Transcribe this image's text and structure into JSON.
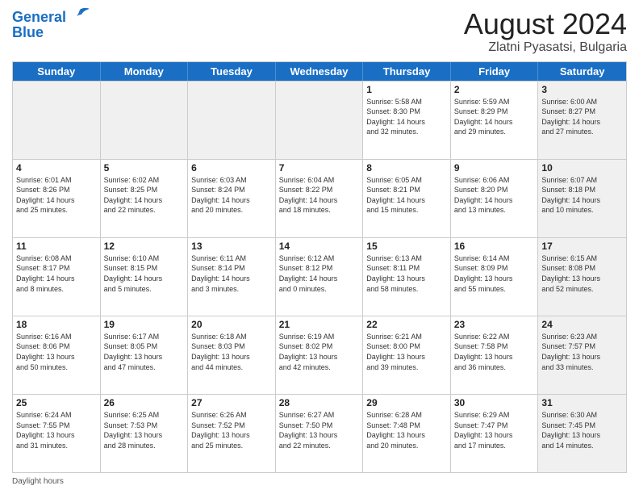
{
  "header": {
    "logo_line1": "General",
    "logo_line2": "Blue",
    "title": "August 2024",
    "subtitle": "Zlatni Pyasatsi, Bulgaria"
  },
  "weekdays": [
    "Sunday",
    "Monday",
    "Tuesday",
    "Wednesday",
    "Thursday",
    "Friday",
    "Saturday"
  ],
  "weeks": [
    [
      {
        "day": "",
        "info": "",
        "shaded": true
      },
      {
        "day": "",
        "info": "",
        "shaded": true
      },
      {
        "day": "",
        "info": "",
        "shaded": true
      },
      {
        "day": "",
        "info": "",
        "shaded": true
      },
      {
        "day": "1",
        "info": "Sunrise: 5:58 AM\nSunset: 8:30 PM\nDaylight: 14 hours\nand 32 minutes.",
        "shaded": false
      },
      {
        "day": "2",
        "info": "Sunrise: 5:59 AM\nSunset: 8:29 PM\nDaylight: 14 hours\nand 29 minutes.",
        "shaded": false
      },
      {
        "day": "3",
        "info": "Sunrise: 6:00 AM\nSunset: 8:27 PM\nDaylight: 14 hours\nand 27 minutes.",
        "shaded": true
      }
    ],
    [
      {
        "day": "4",
        "info": "Sunrise: 6:01 AM\nSunset: 8:26 PM\nDaylight: 14 hours\nand 25 minutes.",
        "shaded": false
      },
      {
        "day": "5",
        "info": "Sunrise: 6:02 AM\nSunset: 8:25 PM\nDaylight: 14 hours\nand 22 minutes.",
        "shaded": false
      },
      {
        "day": "6",
        "info": "Sunrise: 6:03 AM\nSunset: 8:24 PM\nDaylight: 14 hours\nand 20 minutes.",
        "shaded": false
      },
      {
        "day": "7",
        "info": "Sunrise: 6:04 AM\nSunset: 8:22 PM\nDaylight: 14 hours\nand 18 minutes.",
        "shaded": false
      },
      {
        "day": "8",
        "info": "Sunrise: 6:05 AM\nSunset: 8:21 PM\nDaylight: 14 hours\nand 15 minutes.",
        "shaded": false
      },
      {
        "day": "9",
        "info": "Sunrise: 6:06 AM\nSunset: 8:20 PM\nDaylight: 14 hours\nand 13 minutes.",
        "shaded": false
      },
      {
        "day": "10",
        "info": "Sunrise: 6:07 AM\nSunset: 8:18 PM\nDaylight: 14 hours\nand 10 minutes.",
        "shaded": true
      }
    ],
    [
      {
        "day": "11",
        "info": "Sunrise: 6:08 AM\nSunset: 8:17 PM\nDaylight: 14 hours\nand 8 minutes.",
        "shaded": false
      },
      {
        "day": "12",
        "info": "Sunrise: 6:10 AM\nSunset: 8:15 PM\nDaylight: 14 hours\nand 5 minutes.",
        "shaded": false
      },
      {
        "day": "13",
        "info": "Sunrise: 6:11 AM\nSunset: 8:14 PM\nDaylight: 14 hours\nand 3 minutes.",
        "shaded": false
      },
      {
        "day": "14",
        "info": "Sunrise: 6:12 AM\nSunset: 8:12 PM\nDaylight: 14 hours\nand 0 minutes.",
        "shaded": false
      },
      {
        "day": "15",
        "info": "Sunrise: 6:13 AM\nSunset: 8:11 PM\nDaylight: 13 hours\nand 58 minutes.",
        "shaded": false
      },
      {
        "day": "16",
        "info": "Sunrise: 6:14 AM\nSunset: 8:09 PM\nDaylight: 13 hours\nand 55 minutes.",
        "shaded": false
      },
      {
        "day": "17",
        "info": "Sunrise: 6:15 AM\nSunset: 8:08 PM\nDaylight: 13 hours\nand 52 minutes.",
        "shaded": true
      }
    ],
    [
      {
        "day": "18",
        "info": "Sunrise: 6:16 AM\nSunset: 8:06 PM\nDaylight: 13 hours\nand 50 minutes.",
        "shaded": false
      },
      {
        "day": "19",
        "info": "Sunrise: 6:17 AM\nSunset: 8:05 PM\nDaylight: 13 hours\nand 47 minutes.",
        "shaded": false
      },
      {
        "day": "20",
        "info": "Sunrise: 6:18 AM\nSunset: 8:03 PM\nDaylight: 13 hours\nand 44 minutes.",
        "shaded": false
      },
      {
        "day": "21",
        "info": "Sunrise: 6:19 AM\nSunset: 8:02 PM\nDaylight: 13 hours\nand 42 minutes.",
        "shaded": false
      },
      {
        "day": "22",
        "info": "Sunrise: 6:21 AM\nSunset: 8:00 PM\nDaylight: 13 hours\nand 39 minutes.",
        "shaded": false
      },
      {
        "day": "23",
        "info": "Sunrise: 6:22 AM\nSunset: 7:58 PM\nDaylight: 13 hours\nand 36 minutes.",
        "shaded": false
      },
      {
        "day": "24",
        "info": "Sunrise: 6:23 AM\nSunset: 7:57 PM\nDaylight: 13 hours\nand 33 minutes.",
        "shaded": true
      }
    ],
    [
      {
        "day": "25",
        "info": "Sunrise: 6:24 AM\nSunset: 7:55 PM\nDaylight: 13 hours\nand 31 minutes.",
        "shaded": false
      },
      {
        "day": "26",
        "info": "Sunrise: 6:25 AM\nSunset: 7:53 PM\nDaylight: 13 hours\nand 28 minutes.",
        "shaded": false
      },
      {
        "day": "27",
        "info": "Sunrise: 6:26 AM\nSunset: 7:52 PM\nDaylight: 13 hours\nand 25 minutes.",
        "shaded": false
      },
      {
        "day": "28",
        "info": "Sunrise: 6:27 AM\nSunset: 7:50 PM\nDaylight: 13 hours\nand 22 minutes.",
        "shaded": false
      },
      {
        "day": "29",
        "info": "Sunrise: 6:28 AM\nSunset: 7:48 PM\nDaylight: 13 hours\nand 20 minutes.",
        "shaded": false
      },
      {
        "day": "30",
        "info": "Sunrise: 6:29 AM\nSunset: 7:47 PM\nDaylight: 13 hours\nand 17 minutes.",
        "shaded": false
      },
      {
        "day": "31",
        "info": "Sunrise: 6:30 AM\nSunset: 7:45 PM\nDaylight: 13 hours\nand 14 minutes.",
        "shaded": true
      }
    ]
  ],
  "footer": "Daylight hours"
}
